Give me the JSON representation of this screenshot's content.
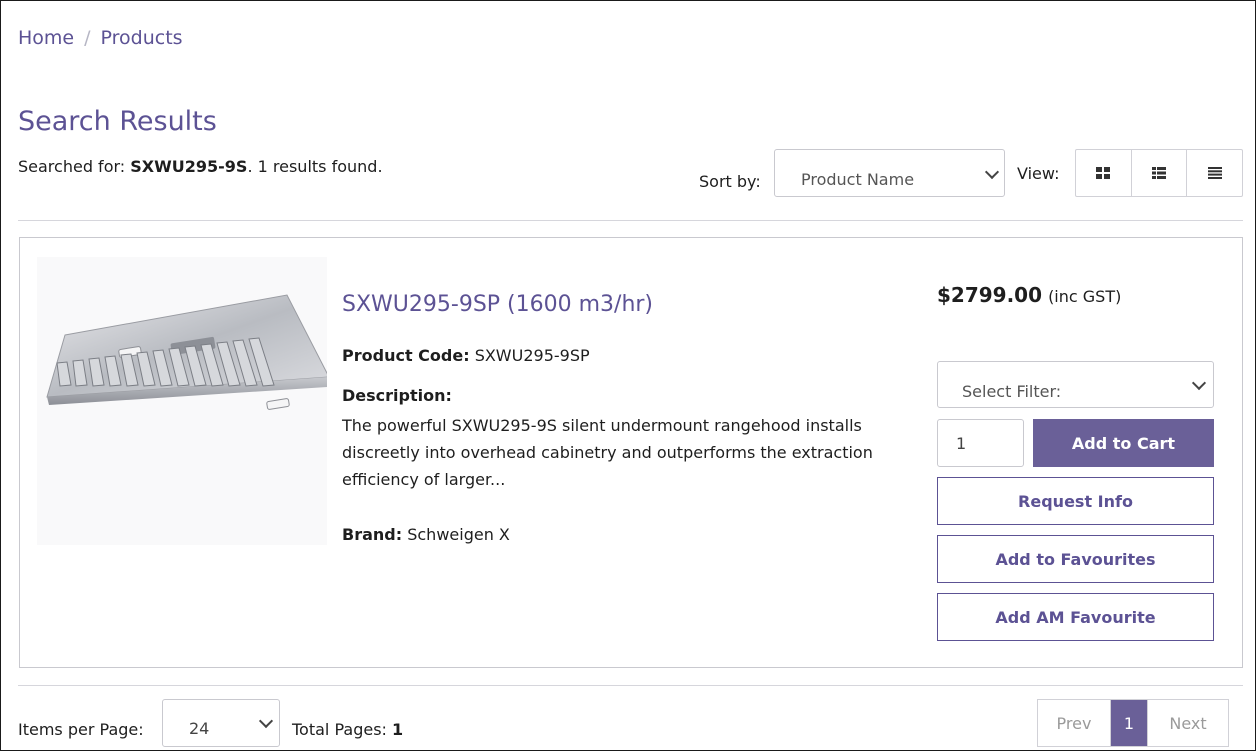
{
  "breadcrumb": {
    "home": "Home",
    "separator": "/",
    "current": "Products"
  },
  "page_title": "Search Results",
  "search": {
    "prefix": "Searched for: ",
    "term": "SXWU295-9S",
    "suffix": ". 1 results found."
  },
  "toolbar": {
    "sort_label": "Sort by:",
    "sort_value": "Product Name",
    "view_label": "View:",
    "view_icons": [
      "grid-icon",
      "list-detail-icon",
      "list-icon"
    ]
  },
  "product": {
    "title": "SXWU295-9SP (1600 m3/hr)",
    "code_label": "Product Code:",
    "code": "SXWU295-9SP",
    "description_label": "Description:",
    "description": "The powerful SXWU295-9S silent undermount rangehood installs discreetly into overhead cabinetry and outperforms the extraction efficiency of larger...",
    "brand_label": "Brand:",
    "brand": "Schweigen X",
    "price": "$2799.00",
    "price_note": "(inc GST)",
    "filter_placeholder": "Select Filter:",
    "quantity": "1",
    "add_to_cart": "Add to Cart",
    "request_info": "Request Info",
    "add_favourites": "Add to Favourites",
    "add_am_favourite": "Add AM Favourite"
  },
  "footer": {
    "items_per_page_label": "Items per Page:",
    "items_per_page": "24",
    "total_pages_label": "Total Pages:",
    "total_pages": "1",
    "prev": "Prev",
    "page": "1",
    "next": "Next"
  },
  "colors": {
    "accent": "#6a6098",
    "link": "#5c5294",
    "border": "#c9c9cf"
  }
}
